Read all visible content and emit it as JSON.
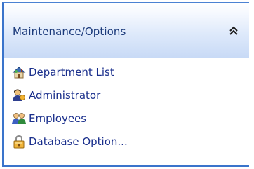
{
  "panel": {
    "title": "Maintenance/Options",
    "collapse_icon": "double-chevron-up-icon",
    "accent_color": "#3a74cb",
    "header_gradient": [
      "#ffffff",
      "#c8daf6"
    ],
    "label_color": "#1a2f8c"
  },
  "items": [
    {
      "label": "Department List",
      "icon": "house-icon"
    },
    {
      "label": "Administrator",
      "icon": "admin-user-icon"
    },
    {
      "label": "Employees",
      "icon": "users-icon"
    },
    {
      "label": "Database Option...",
      "icon": "database-lock-icon"
    }
  ]
}
